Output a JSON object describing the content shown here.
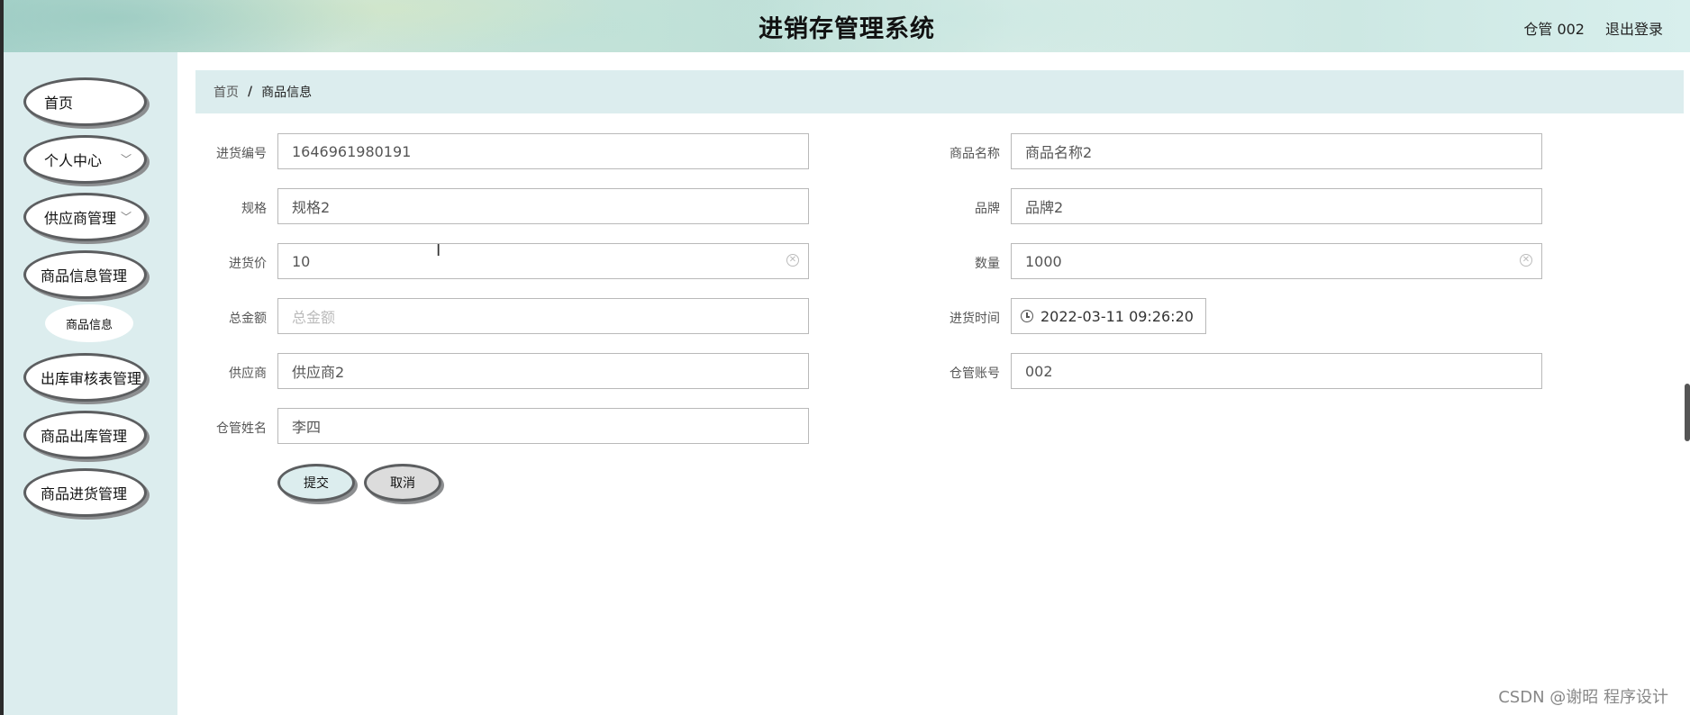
{
  "header": {
    "title": "进销存管理系统",
    "user": "仓管 002",
    "logout": "退出登录"
  },
  "sidebar": {
    "items": [
      {
        "label": "首页"
      },
      {
        "label": "个人中心"
      },
      {
        "label": "供应商管理"
      },
      {
        "label": "商品信息管理"
      },
      {
        "label": "出库审核表管理"
      },
      {
        "label": "商品出库管理"
      },
      {
        "label": "商品进货管理"
      }
    ],
    "submenu": {
      "label": "商品信息"
    }
  },
  "breadcrumb": {
    "home": "首页",
    "separator": "/",
    "current": "商品信息"
  },
  "form": {
    "purchase_no": {
      "label": "进货编号",
      "value": "1646961980191"
    },
    "product_name": {
      "label": "商品名称",
      "value": "商品名称2"
    },
    "spec": {
      "label": "规格",
      "value": "规格2"
    },
    "brand": {
      "label": "品牌",
      "value": "品牌2"
    },
    "purchase_price": {
      "label": "进货价",
      "value": "10"
    },
    "quantity": {
      "label": "数量",
      "value": "1000"
    },
    "total_amount": {
      "label": "总金额",
      "placeholder": "总金额"
    },
    "purchase_time": {
      "label": "进货时间",
      "value": "2022-03-11 09:26:20"
    },
    "supplier": {
      "label": "供应商",
      "value": "供应商2"
    },
    "keeper_account": {
      "label": "仓管账号",
      "value": "002"
    },
    "keeper_name": {
      "label": "仓管姓名",
      "value": "李四"
    }
  },
  "buttons": {
    "submit": "提交",
    "cancel": "取消"
  },
  "watermark": "CSDN @谢昭 程序设计"
}
